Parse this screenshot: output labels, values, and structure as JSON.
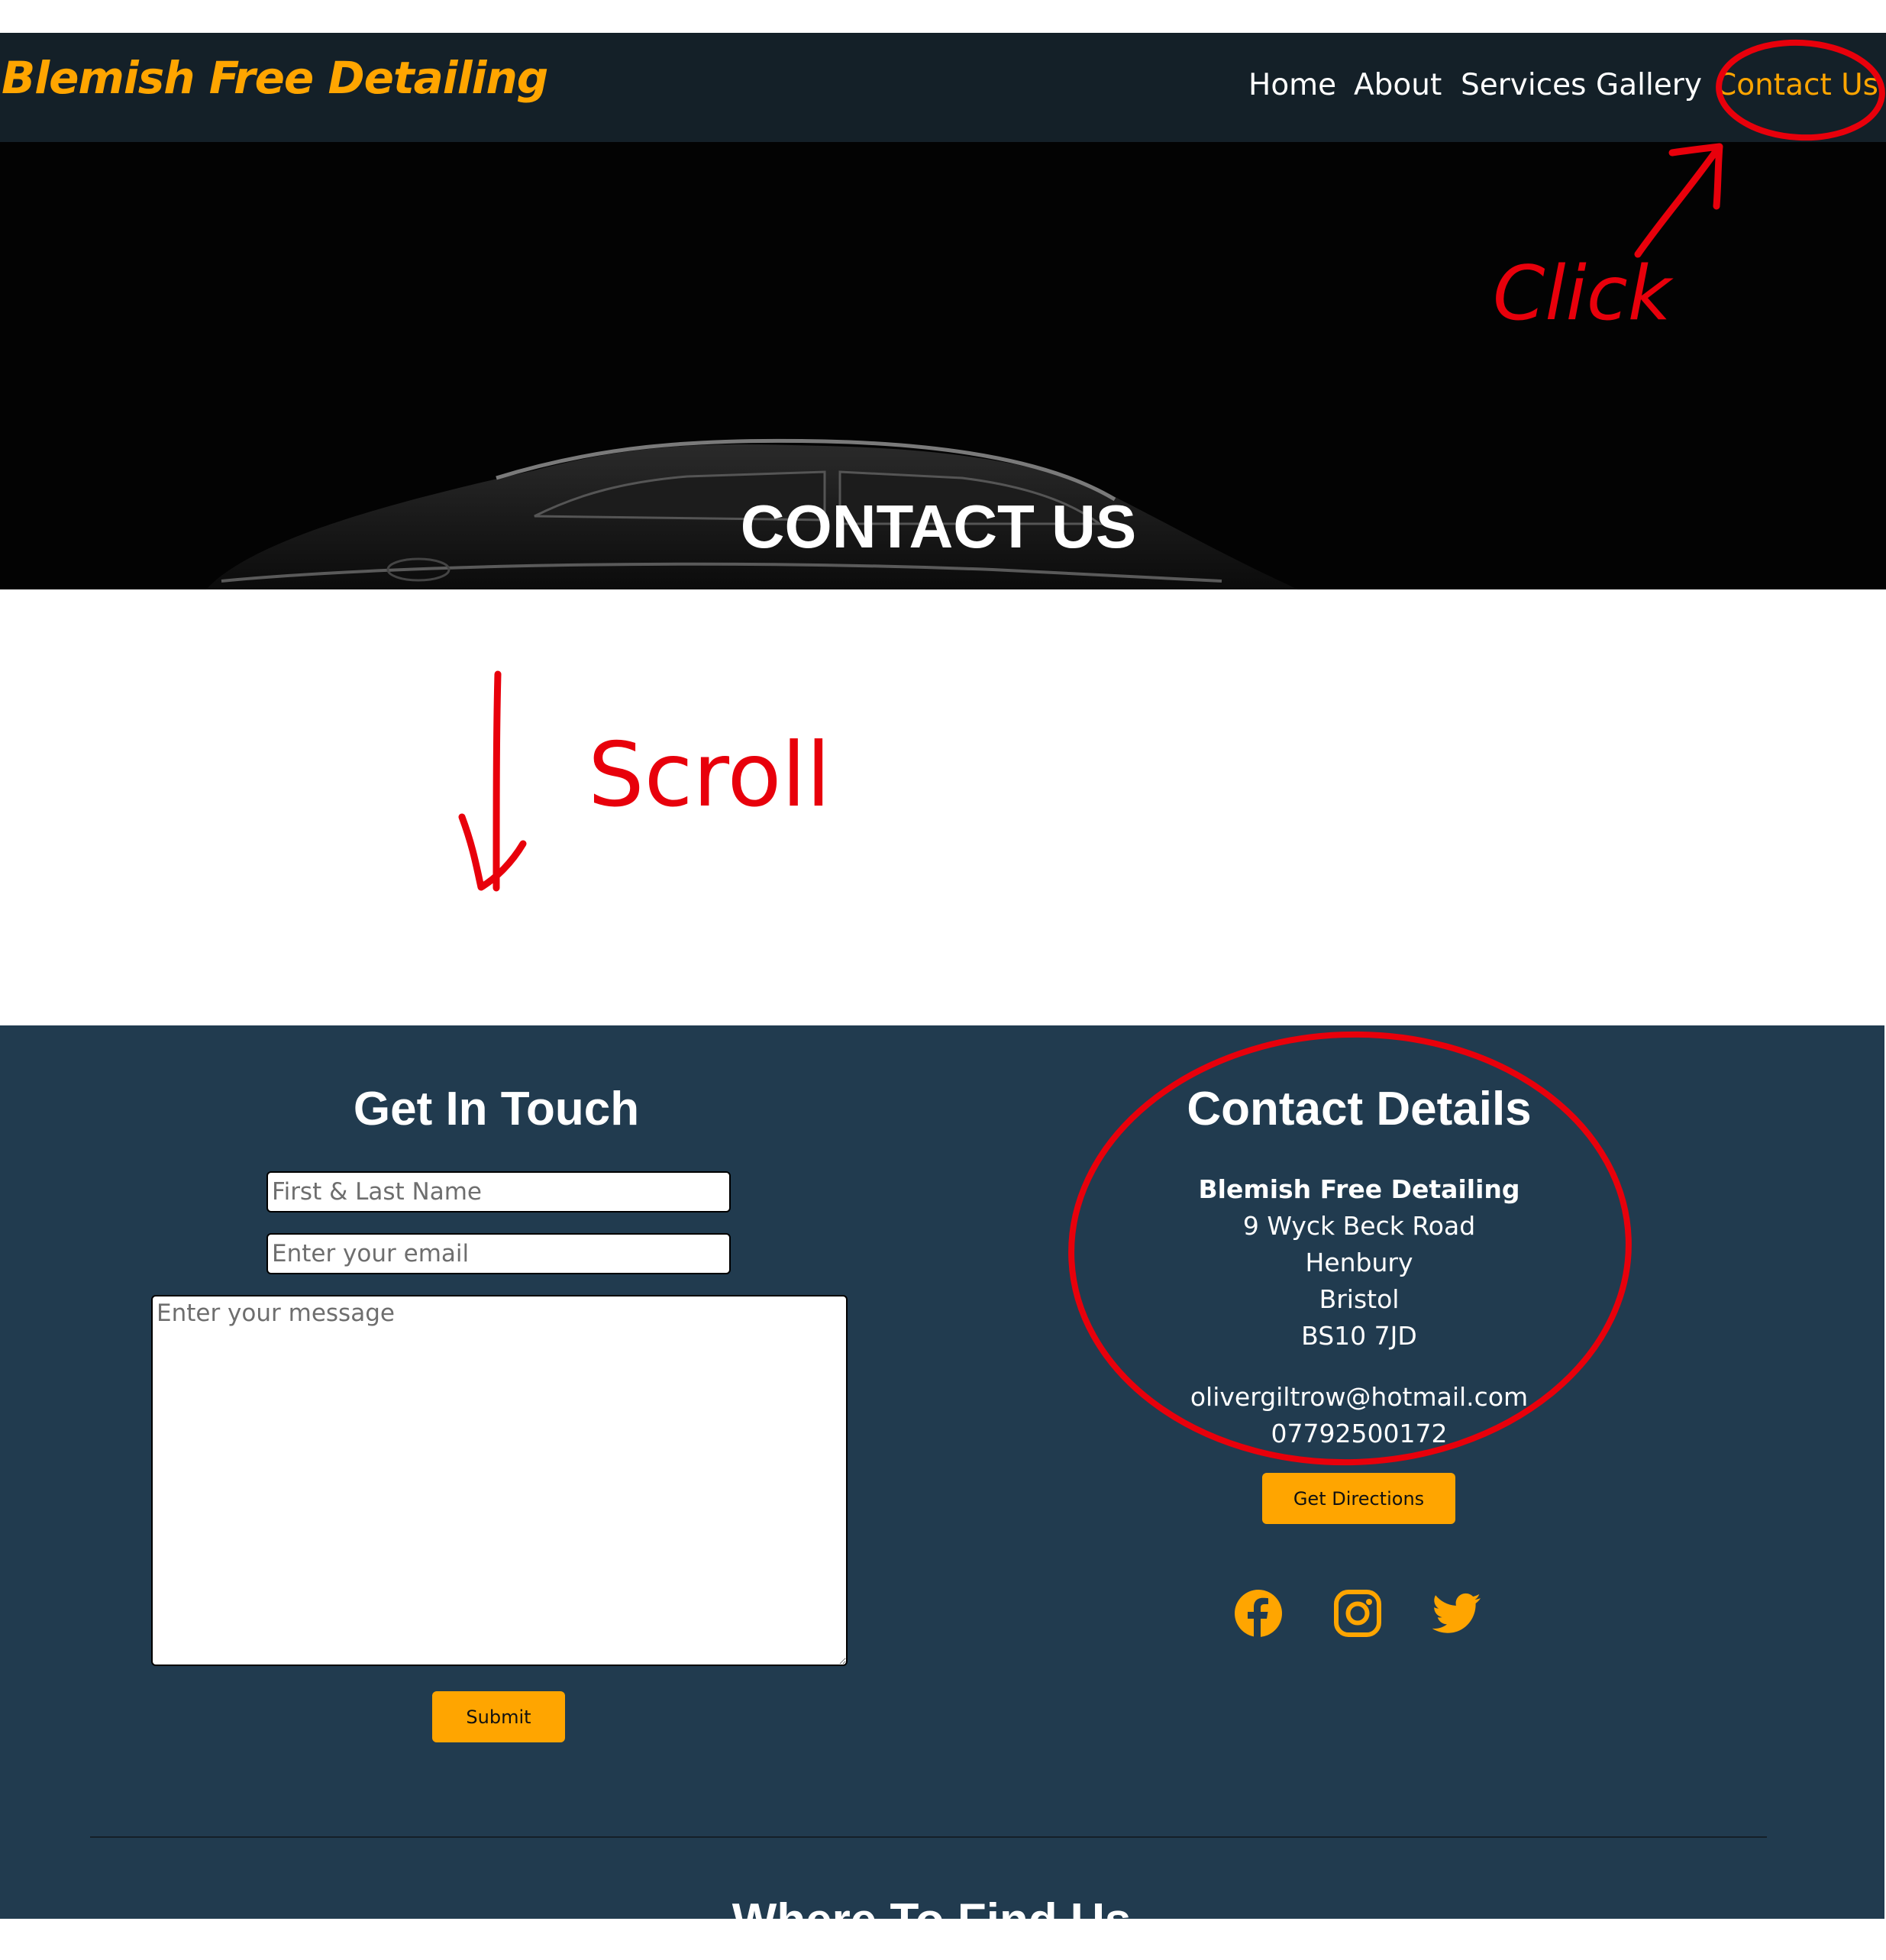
{
  "nav": {
    "brand": "Blemish Free Detailing",
    "items": [
      "Home",
      "About",
      "Services",
      "Gallery",
      "Contact Us"
    ],
    "active_item": "Contact Us"
  },
  "hero": {
    "title": "CONTACT US"
  },
  "form": {
    "heading": "Get In Touch",
    "name_placeholder": "First & Last Name",
    "email_placeholder": "Enter your email",
    "message_placeholder": "Enter your message",
    "submit_label": "Submit"
  },
  "details": {
    "heading": "Contact Details",
    "business_name": "Blemish Free Detailing",
    "address_line1": "9 Wyck Beck Road",
    "address_line2": "Henbury",
    "address_line3": "Bristol",
    "postcode": "BS10 7JD",
    "email": "olivergiltrow@hotmail.com",
    "phone": "07792500172",
    "directions_label": "Get Directions",
    "social": [
      "facebook-icon",
      "instagram-icon",
      "twitter-icon"
    ]
  },
  "find_us": {
    "heading": "Where To Find Us"
  },
  "annotations": {
    "click": "Click",
    "scroll": "Scroll"
  },
  "colors": {
    "accent": "#ffa500",
    "nav_bg": "#142028",
    "section_bg": "#213b4f",
    "annotation": "#e8000b"
  }
}
